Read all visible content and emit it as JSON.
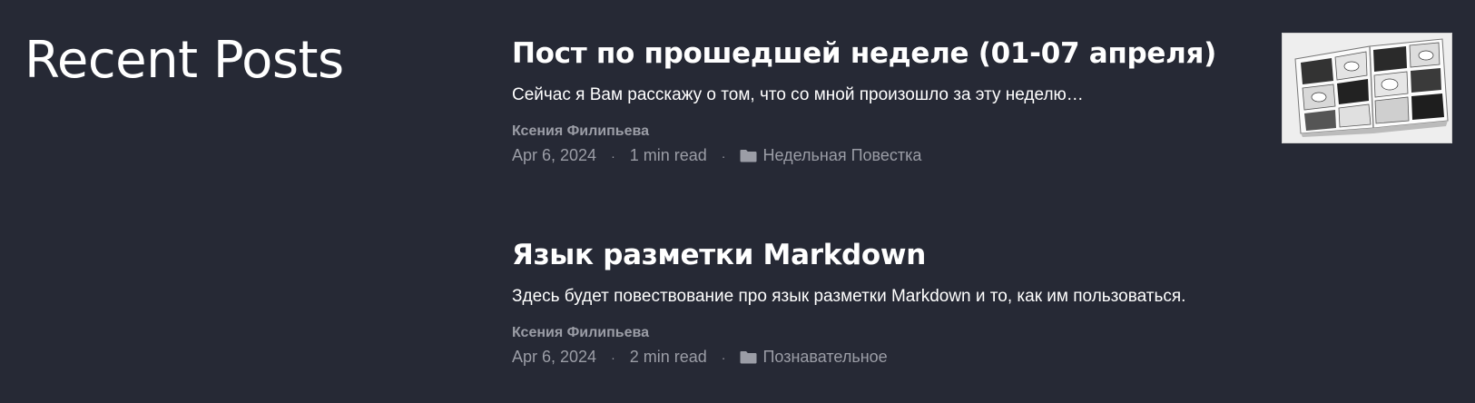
{
  "section": {
    "title": "Recent Posts"
  },
  "posts": [
    {
      "title": "Пост по прошедшей неделе (01-07 апреля)",
      "excerpt": "Сейчас я Вам расскажу о том, что со мной произошло за эту неделю…",
      "author": "Ксения Филипьева",
      "date": "Apr 6, 2024",
      "read_time": "1 min read",
      "separator": "·",
      "category": "Недельная Повестка",
      "category_icon": "folder-icon",
      "thumbnail": "manga-pages-thumbnail"
    },
    {
      "title": "Язык разметки Markdown",
      "excerpt": "Здесь будет повествование про язык разметки Markdown и то, как им пользоваться.",
      "author": "Ксения Филипьева",
      "date": "Apr 6, 2024",
      "read_time": "2 min read",
      "separator": "·",
      "category": "Познавательное",
      "category_icon": "folder-icon"
    }
  ],
  "colors": {
    "background": "#262935",
    "heading": "#ffffff",
    "meta": "#9b9da6"
  }
}
